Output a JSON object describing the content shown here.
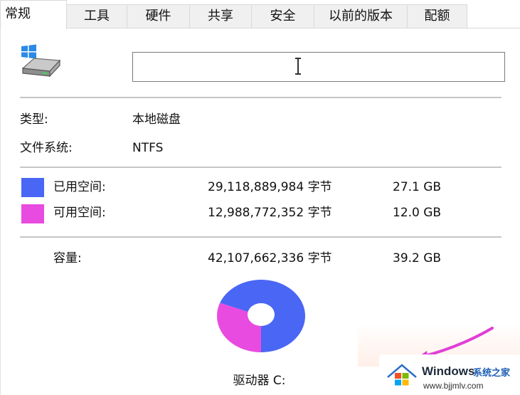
{
  "tabs": [
    {
      "label": "常规",
      "active": true
    },
    {
      "label": "工具",
      "active": false
    },
    {
      "label": "硬件",
      "active": false
    },
    {
      "label": "共享",
      "active": false
    },
    {
      "label": "安全",
      "active": false
    },
    {
      "label": "以前的版本",
      "active": false
    },
    {
      "label": "配额",
      "active": false
    }
  ],
  "drive_name_input": {
    "value": "",
    "placeholder": ""
  },
  "info": {
    "type_label": "类型:",
    "type_value": "本地磁盘",
    "fs_label": "文件系统:",
    "fs_value": "NTFS"
  },
  "usage": {
    "used": {
      "label": "已用空间:",
      "bytes": "29,118,889,984 字节",
      "size": "27.1 GB",
      "color": "#4a66f5"
    },
    "free": {
      "label": "可用空间:",
      "bytes": "12,988,772,352 字节",
      "size": "12.0 GB",
      "color": "#e84be0"
    },
    "capacity": {
      "label": "容量:",
      "bytes": "42,107,662,336 字节",
      "size": "39.2 GB"
    }
  },
  "pie": {
    "used_fraction": 0.6915,
    "free_fraction": 0.3085
  },
  "drive_label": "驱动器 C:",
  "watermark": {
    "brand": "Windows",
    "site_cn": "系统之家",
    "url": "www.bjjmlv.com"
  },
  "icons": {
    "drive": "drive-icon",
    "text_cursor": "text-cursor-icon",
    "watermark_logo": "windows-logo-icon"
  }
}
